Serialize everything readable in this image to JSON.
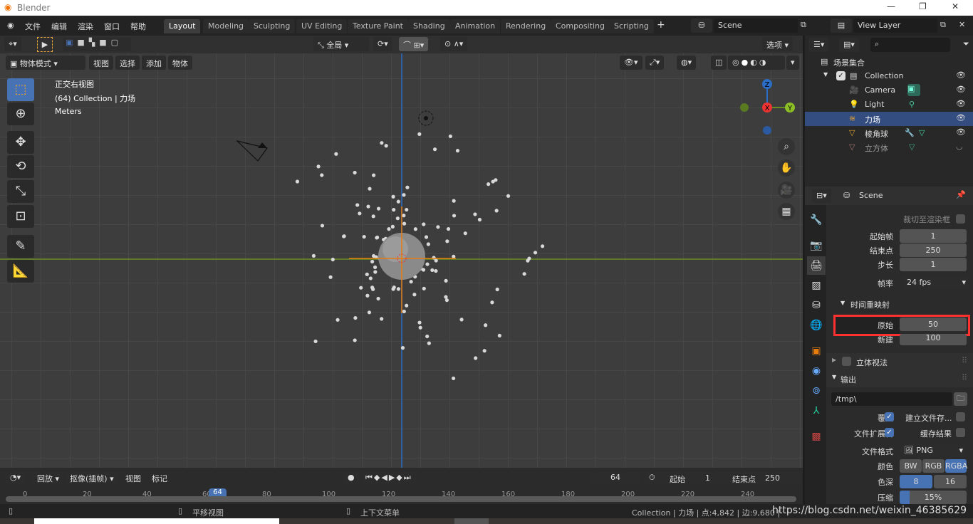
{
  "title": "Blender",
  "menu": [
    "文件",
    "编辑",
    "渲染",
    "窗口",
    "帮助"
  ],
  "workspaces": [
    "Layout",
    "Modeling",
    "Sculpting",
    "UV Editing",
    "Texture Paint",
    "Shading",
    "Animation",
    "Rendering",
    "Compositing",
    "Scripting"
  ],
  "scene": "Scene",
  "view_layer": "View Layer",
  "header": {
    "transform_orientation": "全局",
    "options": "选项",
    "mode": "物体模式",
    "view": "视图",
    "select": "选择",
    "add": "添加",
    "object": "物体"
  },
  "overlay": {
    "view_name": "正交右视图",
    "collection": "(64) Collection | 力场",
    "units": "Meters"
  },
  "gizmo": {
    "z": "Z",
    "y": "Y",
    "x": "X"
  },
  "outliner": {
    "root": "场景集合",
    "items": [
      {
        "name": "Collection"
      },
      {
        "name": "Camera"
      },
      {
        "name": "Light"
      },
      {
        "name": "力场"
      },
      {
        "name": "棱角球"
      },
      {
        "name": "立方体"
      }
    ]
  },
  "properties": {
    "context": "Scene",
    "crop": "裁切至渲染框",
    "frame_start_label": "起始帧",
    "frame_start": "1",
    "frame_end_label": "结束点",
    "frame_end": "250",
    "step_label": "步长",
    "step": "1",
    "fps_label": "帧率",
    "fps": "24 fps",
    "time_remap": "时间重映射",
    "old_label": "原始",
    "old": "50",
    "new_label": "新建",
    "new": "100",
    "stereo": "立体视法",
    "output": "输出",
    "path": "/tmp\\",
    "overwrite": "覆盖",
    "placeholders": "建立文件存...",
    "ext": "文件扩展名",
    "cache": "缓存结果",
    "format_label": "文件格式",
    "format": "PNG",
    "color_label": "颜色",
    "color_opts": [
      "BW",
      "RGB",
      "RGBA"
    ],
    "depth_label": "色深",
    "depth_opts": [
      "8",
      "16"
    ],
    "compress_label": "压缩",
    "compress": "15%",
    "compress_value": 15
  },
  "timeline": {
    "playback": "回放",
    "keying": "抠像(插帧)",
    "view": "视图",
    "marker": "标记",
    "current": "64",
    "start_label": "起始",
    "start": "1",
    "end_label": "结束点",
    "end": "250",
    "ticks": [
      "0",
      "20",
      "40",
      "60",
      "80",
      "100",
      "120",
      "140",
      "160",
      "180",
      "200",
      "220",
      "240"
    ]
  },
  "status": {
    "pan": "平移视图",
    "context_menu": "上下文菜单",
    "stats": "Collection | 力场 | 点:4,842 | 边:9,680 |",
    "watermark": "https://blog.csdn.net/weixin_46385629"
  },
  "colors": {
    "accent": "#4772b3",
    "highlight": "#ff3030",
    "x_axis": "#6b8e23",
    "y_axis": "#2b6cc4"
  }
}
